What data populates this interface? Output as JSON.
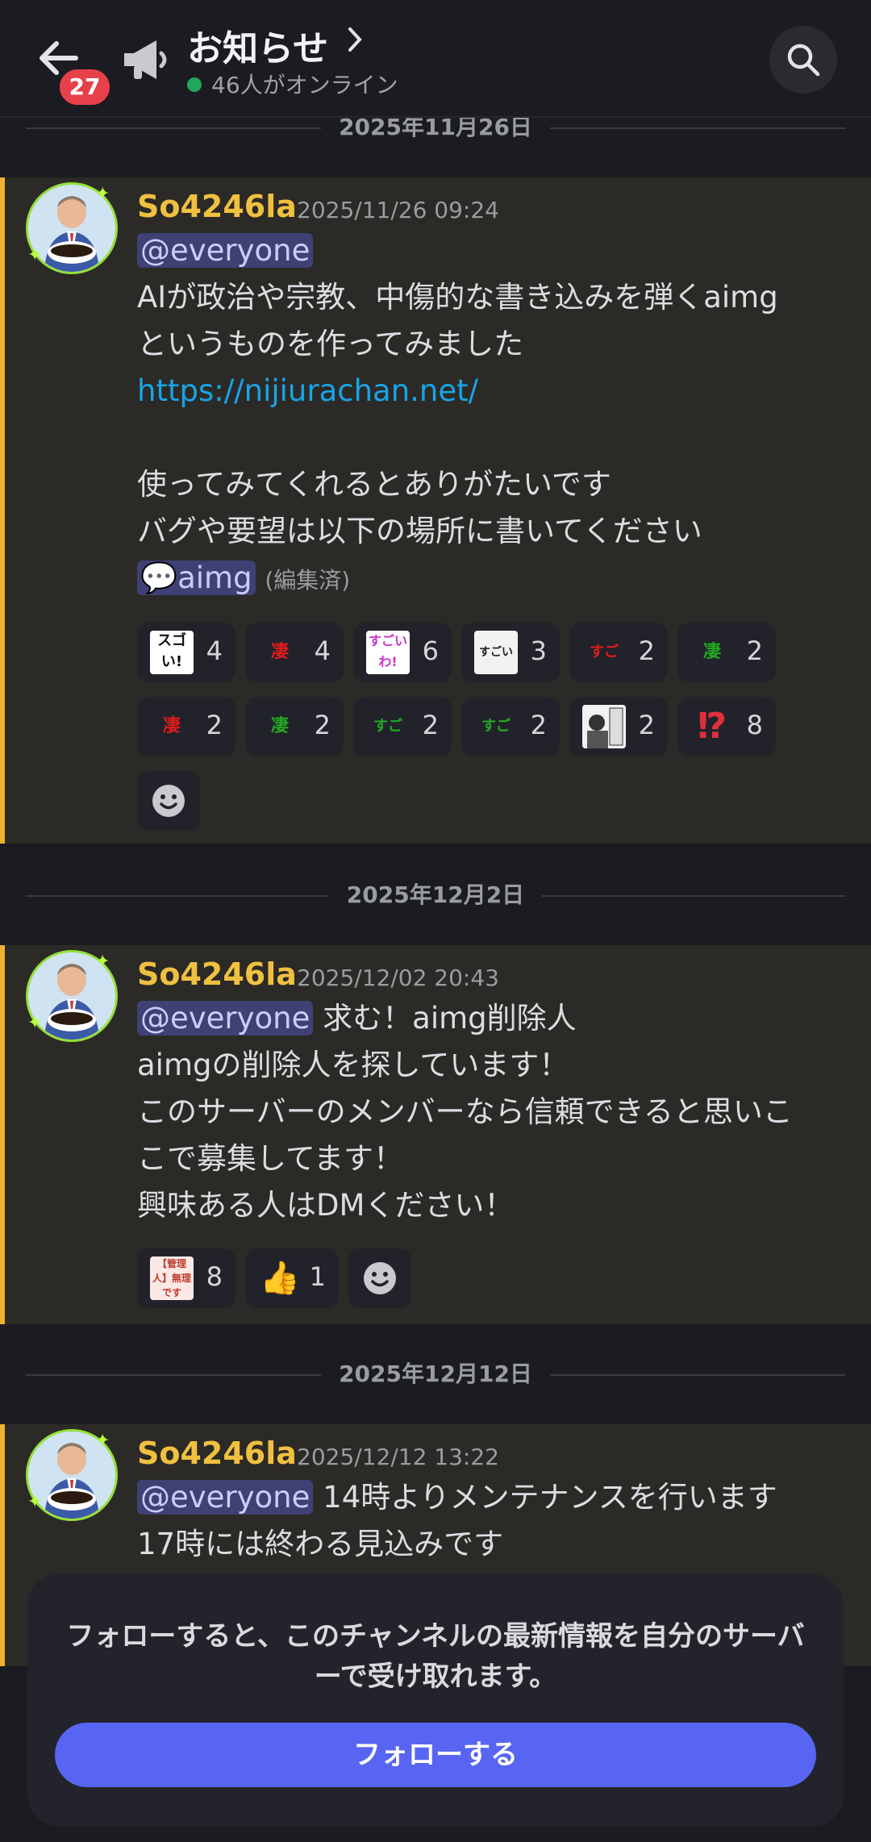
{
  "header": {
    "channel_name": "お知らせ",
    "unread_badge": "27",
    "online_text": "46人がオンライン"
  },
  "separators": [
    "2025年11月26日",
    "2025年12月2日",
    "2025年12月12日"
  ],
  "messages": [
    {
      "author": "So4246la",
      "timestamp": "2025/11/26 09:24",
      "mention": "@everyone",
      "lines": [
        "AIが政治や宗教、中傷的な書き込みを弾くaimg",
        "というものを作ってみました"
      ],
      "link": "https://nijiurachan.net/",
      "lines2": [
        "使ってみてくれるとありがたいです",
        "バグや要望は以下の場所に書いてください"
      ],
      "channel_mention": "aimg",
      "edited": "(編集済)",
      "reactions": [
        {
          "emoji_text": "スゴい!",
          "count": "4",
          "color": "#111111"
        },
        {
          "emoji_text": "凄ぇ!",
          "count": "4",
          "color": "#e21b1b"
        },
        {
          "emoji_text": "すごいわ!",
          "count": "6",
          "color": "#cc33cc"
        },
        {
          "emoji_text": "すごい",
          "count": "3",
          "color": "#222222"
        },
        {
          "emoji_text": "すごい!!",
          "count": "2",
          "color": "#e21b1b"
        },
        {
          "emoji_text": "凄ぇ!",
          "count": "2",
          "color": "#22aa22"
        },
        {
          "emoji_text": "凄ぇ!",
          "count": "2",
          "color": "#e21b1b"
        },
        {
          "emoji_text": "凄ぇ!",
          "count": "2",
          "color": "#22aa22"
        },
        {
          "emoji_text": "すごい!!",
          "count": "2",
          "color": "#22aa22"
        },
        {
          "emoji_text": "すごい!!",
          "count": "2",
          "color": "#22aa22"
        },
        {
          "emoji_text": "manga",
          "count": "2",
          "color": "#222222"
        },
        {
          "emoji_text": "⁉",
          "count": "8",
          "color": "#e0303a"
        }
      ]
    },
    {
      "author": "So4246la",
      "timestamp": "2025/12/02 20:43",
      "mention": "@everyone",
      "first_line_rest": " 求む！aimg削除人",
      "lines": [
        "aimgの削除人を探しています！",
        "このサーバーのメンバーなら信頼できると思いこ",
        "こで募集してます！",
        "興味ある人はDMください！"
      ],
      "reactions": [
        {
          "emoji_text": "【管理人】無理です",
          "count": "8",
          "color": "#c0392b"
        },
        {
          "emoji_text": "👍",
          "count": "1",
          "color": "#f6c33b"
        }
      ]
    },
    {
      "author": "So4246la",
      "timestamp": "2025/12/12 13:22",
      "mention": "@everyone",
      "first_line_rest": " 14時よりメンテナンスを行います",
      "lines": [
        "17時には終わる見込みです"
      ]
    }
  ],
  "follow": {
    "text_line1": "フォローすると、このチャンネルの最新情報を自分のサーバ",
    "text_line2": "ーで受け取れます。",
    "button_label": "フォローする"
  }
}
